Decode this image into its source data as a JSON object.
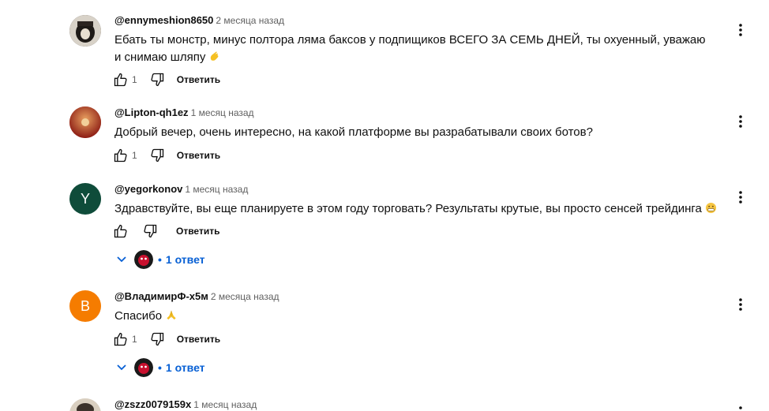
{
  "actions": {
    "reply_label": "Ответить"
  },
  "comments": [
    {
      "author": "@ennymeshion8650",
      "time": "2 месяца назад",
      "text": "Ебать ты монстр, минус полтора ляма баксов у подпищиков ВСЕГО ЗА СЕМЬ ДНЕЙ, ты охуенный, уважаю и снимаю шляпу",
      "emoji": "hand-icon",
      "likes": "1"
    },
    {
      "author": "@Lipton-qh1ez",
      "time": "1 месяц назад",
      "text": "Добрый вечер, очень интересно, на какой платформе вы разрабатывали своих ботов?",
      "likes": "1"
    },
    {
      "author": "@yegorkonov",
      "time": "1 месяц назад",
      "text": "Здравствуйте, вы еще планируете в этом году торговать? Результаты крутые, вы просто сенсей трейдинга",
      "emoji": "grin-icon",
      "avatar_letter": "Y",
      "avatar_color": "#0f4c3a",
      "likes": "",
      "replies": "1 ответ"
    },
    {
      "author": "@ВладимирФ-х5м",
      "time": "2 месяца назад",
      "text": "Спасибо",
      "emoji": "pray-icon",
      "avatar_letter": "В",
      "avatar_color": "#f57c00",
      "likes": "1",
      "replies": "1 ответ"
    },
    {
      "author": "@zszz0079159x",
      "time": "1 месяц назад"
    }
  ],
  "colors": {
    "link_blue": "#065fd4",
    "meta_gray": "#606060",
    "text": "#0f0f0f"
  }
}
